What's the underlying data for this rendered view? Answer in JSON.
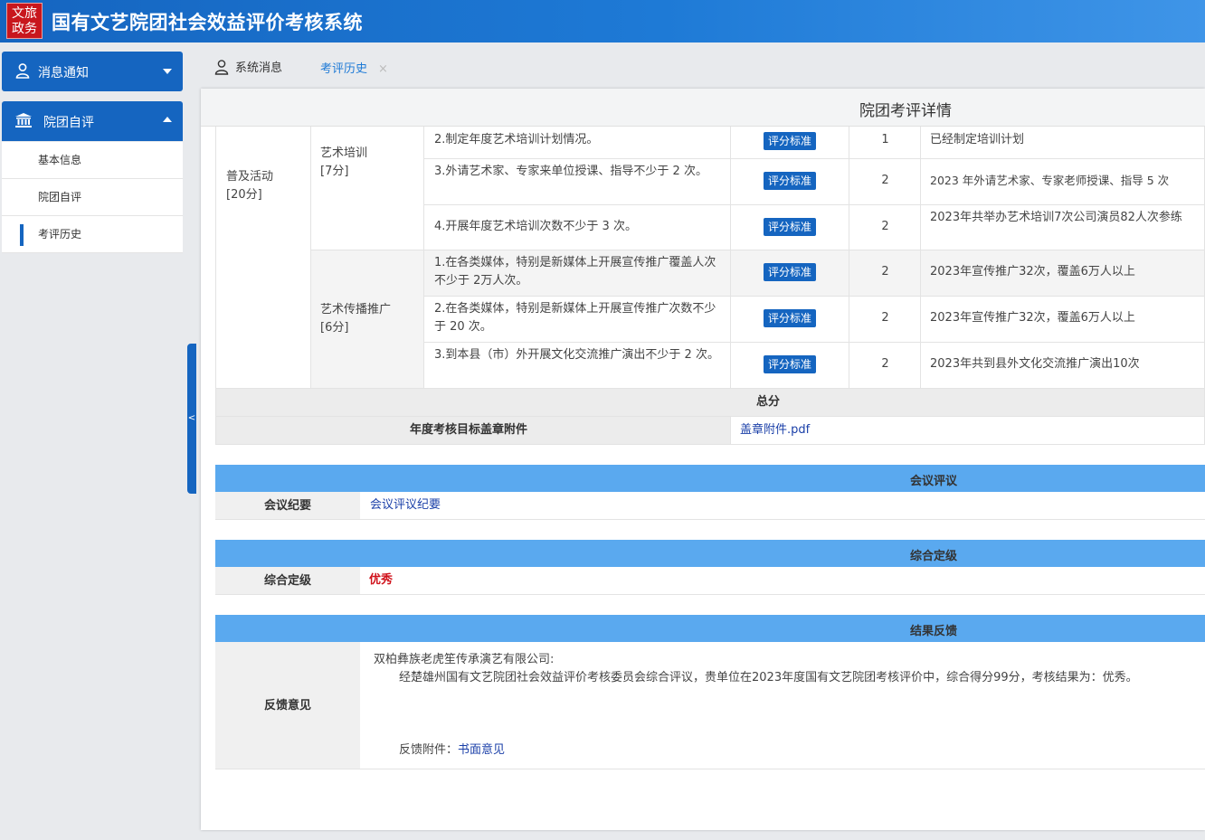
{
  "header": {
    "logo_line1": "文旅",
    "logo_line2": "政务",
    "title": "国有文艺院团社会效益评价考核系统"
  },
  "sidebar": {
    "msg_label": "消息通知",
    "group_label": "院团自评",
    "items": [
      {
        "label": "基本信息"
      },
      {
        "label": "院团自评"
      },
      {
        "label": "考评历史"
      }
    ],
    "collapse_glyph": "<"
  },
  "tabs": {
    "system": "系统消息",
    "history": "考评历史",
    "close": "×"
  },
  "page": {
    "title": "院团考评详情",
    "category": "普及活动",
    "category_score": "[20分]",
    "sub1": "艺术培训",
    "sub1_score": "[7分]",
    "sub2": "艺术传播推广",
    "sub2_score": "[6分]",
    "std_btn": "评分标准",
    "rows": [
      {
        "item": "2.制定年度艺术培训计划情况。",
        "score": "1",
        "desc": "已经制定培训计划"
      },
      {
        "item": "3.外请艺术家、专家来单位授课、指导不少于 2 次。",
        "score": "2",
        "desc": "2023 年外请艺术家、专家老师授课、指导 5 次"
      },
      {
        "item": "4.开展年度艺术培训次数不少于 3 次。",
        "score": "2",
        "desc": "2023年共举办艺术培训7次公司演员82人次参练"
      },
      {
        "item": "1.在各类媒体，特别是新媒体上开展宣传推广覆盖人次不少于 2万人次。",
        "score": "2",
        "desc": "2023年宣传推广32次，覆盖6万人以上"
      },
      {
        "item": "2.在各类媒体，特别是新媒体上开展宣传推广次数不少于 20 次。",
        "score": "2",
        "desc": "2023年宣传推广32次，覆盖6万人以上"
      },
      {
        "item": "3.到本县（市）外开展文化交流推广演出不少于 2 次。",
        "score": "2",
        "desc": "2023年共到县外文化交流推广演出10次"
      }
    ],
    "total_label": "总分",
    "attach_label": "年度考核目标盖章附件",
    "attach_link": "盖章附件.pdf"
  },
  "meeting": {
    "header": "会议评议",
    "label": "会议纪要",
    "link": "会议评议纪要"
  },
  "grade": {
    "header": "综合定级",
    "label": "综合定级",
    "value": "优秀"
  },
  "feedback": {
    "header": "结果反馈",
    "label": "反馈意见",
    "company": "双柏彝族老虎笙传承演艺有限公司:",
    "body": "经楚雄州国有文艺院团社会效益评价考核委员会综合评议，贵单位在2023年度国有文艺院团考核评价中，综合得分99分，考核结果为：优秀。",
    "attach_prefix": "反馈附件：",
    "attach_link": "书面意见"
  },
  "colors": {
    "primary": "#1565c0",
    "section_bar": "#5aa9ef",
    "grade_red": "#d0121b"
  }
}
